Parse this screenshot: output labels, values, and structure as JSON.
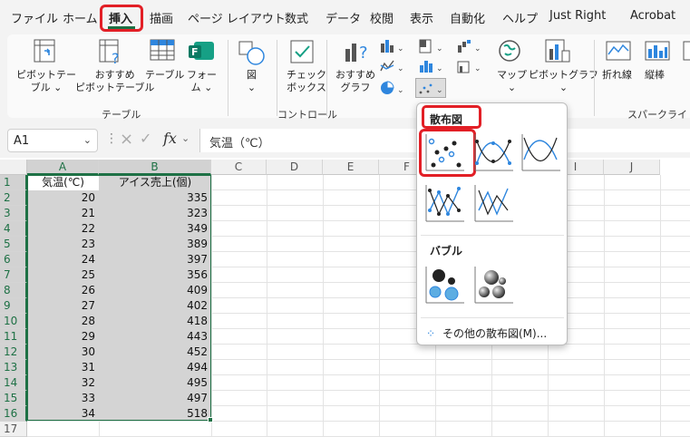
{
  "tabs": [
    "ファイル",
    "ホーム",
    "挿入",
    "描画",
    "ページ レイアウト",
    "数式",
    "データ",
    "校閲",
    "表示",
    "自動化",
    "ヘルプ",
    "Just Right",
    "Acrobat"
  ],
  "active_tab": "挿入",
  "ribbon": {
    "pivot_table": [
      "ピボットテー",
      "ブル ⌄"
    ],
    "recommended_pivot": [
      "おすすめ",
      "ピボットテーブル"
    ],
    "table": "テーブル",
    "forms": [
      "フォー",
      "ム ⌄"
    ],
    "shapes": [
      "図",
      "⌄"
    ],
    "checkbox": [
      "チェック",
      "ボックス"
    ],
    "recommended_charts": [
      "おすすめ",
      "グラフ"
    ],
    "maps": [
      "マップ",
      "⌄"
    ],
    "pivot_chart": [
      "ピボットグラフ",
      "⌄"
    ],
    "sparkline_line": "折れ線",
    "sparkline_column": "縦棒",
    "group_table": "テーブル",
    "group_control": "コントロール",
    "group_sparklines": "スパークライン"
  },
  "formula_bar": {
    "name_box": "A1",
    "formula": "気温（℃）"
  },
  "columns": [
    "A",
    "B",
    "C",
    "D",
    "E",
    "F",
    "G",
    "H",
    "I",
    "J"
  ],
  "rows": [
    "1",
    "2",
    "3",
    "4",
    "5",
    "6",
    "7",
    "8",
    "9",
    "10",
    "11",
    "12",
    "13",
    "14",
    "15",
    "16",
    "17"
  ],
  "table": {
    "headers": [
      "気温(℃)",
      "アイス売上(個)"
    ],
    "data": [
      [
        "20",
        "335"
      ],
      [
        "21",
        "323"
      ],
      [
        "22",
        "349"
      ],
      [
        "23",
        "389"
      ],
      [
        "24",
        "397"
      ],
      [
        "25",
        "356"
      ],
      [
        "26",
        "409"
      ],
      [
        "27",
        "402"
      ],
      [
        "28",
        "418"
      ],
      [
        "29",
        "443"
      ],
      [
        "30",
        "452"
      ],
      [
        "31",
        "494"
      ],
      [
        "32",
        "495"
      ],
      [
        "33",
        "497"
      ],
      [
        "34",
        "518"
      ]
    ]
  },
  "dropdown": {
    "scatter_heading": "散布図",
    "bubble_heading": "バブル",
    "more": "その他の散布図(M)..."
  },
  "colors": {
    "accent": "#1e7145",
    "highlight": "#e21f26",
    "selection_fill": "#d4d4d4",
    "chart_blue": "#2e86de"
  }
}
